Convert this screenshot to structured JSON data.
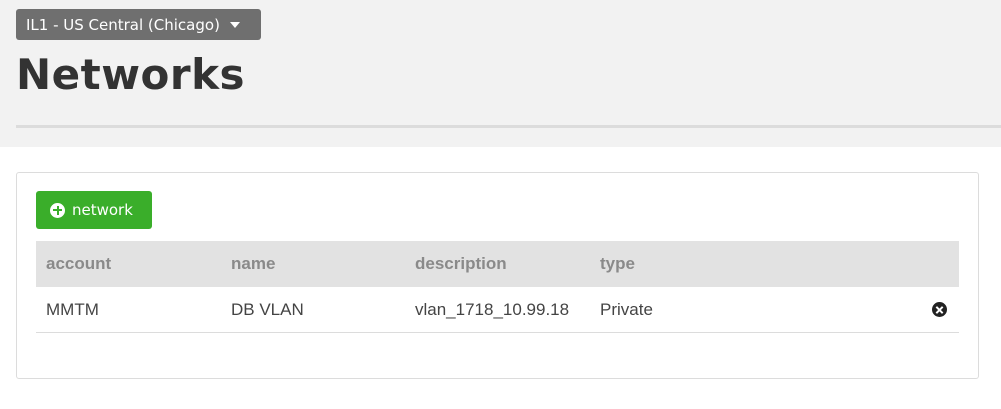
{
  "header": {
    "region_selector": "IL1 - US Central (Chicago)",
    "title": "Networks"
  },
  "toolbar": {
    "add_network_label": "network"
  },
  "table": {
    "columns": [
      "account",
      "name",
      "description",
      "type"
    ],
    "rows": [
      {
        "account": "MMTM",
        "name": "DB VLAN",
        "description": "vlan_1718_10.99.18",
        "type": "Private",
        "action_icon": "remove-circle-icon"
      }
    ]
  },
  "colors": {
    "accent_green": "#3aae2a",
    "region_button": "#6f6f6f",
    "header_bg": "#f2f2f2"
  }
}
